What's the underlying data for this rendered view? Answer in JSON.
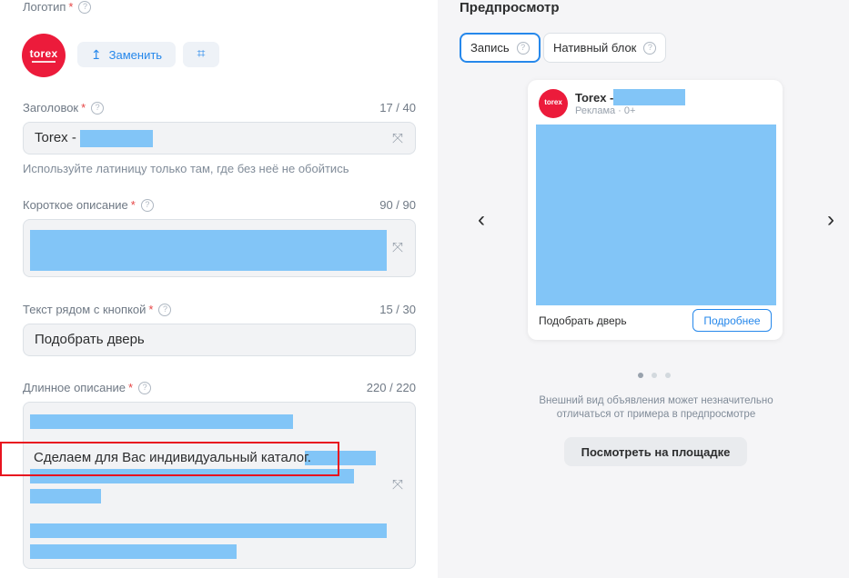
{
  "form": {
    "logo": {
      "label": "Логотип",
      "required_mark": "*",
      "logo_text": "torex",
      "replace_label": "Заменить"
    },
    "headline": {
      "label": "Заголовок",
      "required_mark": "*",
      "counter": "17 / 40",
      "value": "Torex -",
      "hint": "Используйте латиницу только там, где без неё не обойтись"
    },
    "short_description": {
      "label": "Короткое описание",
      "required_mark": "*",
      "counter": "90 / 90"
    },
    "button_text": {
      "label": "Текст рядом с кнопкой",
      "required_mark": "*",
      "counter": "15 / 30",
      "value": "Подобрать дверь"
    },
    "long_description": {
      "label": "Длинное описание",
      "required_mark": "*",
      "counter": "220 / 220",
      "visible_line": "Сделаем для Вас индивидуальный каталог."
    }
  },
  "preview": {
    "title": "Предпросмотр",
    "tabs": [
      {
        "label": "Запись",
        "active": true
      },
      {
        "label": "Нативный блок",
        "active": false
      }
    ],
    "card": {
      "avatar_text": "torex",
      "name": "Torex -",
      "meta": "Реклама · 0+",
      "cta_text": "Подобрать дверь",
      "cta_button": "Подробнее"
    },
    "pager": {
      "total": 3,
      "current": 1
    },
    "note": "Внешний вид объявления может незначительно отличаться от примера в предпросмотре",
    "view_button": "Посмотреть на площадке"
  },
  "icons": {
    "help": "?",
    "upload": "↥",
    "crop": "⌗",
    "magic": "⤧",
    "arrow_left": "‹",
    "arrow_right": "›"
  },
  "colors": {
    "accent": "#2688eb",
    "brand_red": "#ec1b3b",
    "redaction": "#82c5f7",
    "highlight": "#e8131f"
  }
}
